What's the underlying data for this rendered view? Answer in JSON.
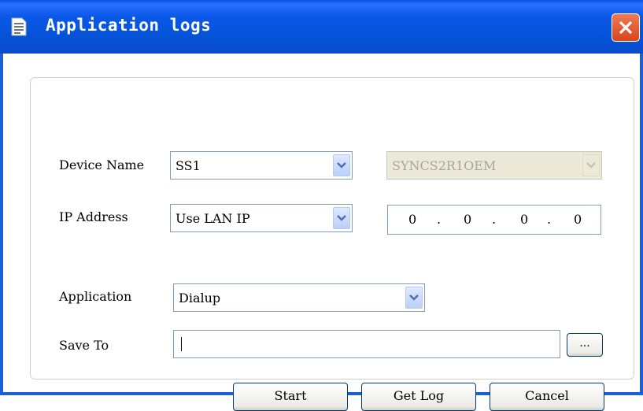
{
  "window": {
    "title": "Application logs",
    "title_icon": "document-icon",
    "close_icon": "close-icon"
  },
  "form": {
    "device_name": {
      "label": "Device Name",
      "value": "SS1",
      "secondary_value": "SYNCS2R1OEM"
    },
    "ip_address": {
      "label": "IP Address",
      "value": "Use LAN IP",
      "octets": [
        "0",
        "0",
        "0",
        "0"
      ],
      "separator": "."
    },
    "application": {
      "label": "Application",
      "value": "Dialup"
    },
    "save_to": {
      "label": "Save To",
      "value": "",
      "browse_label": "..."
    }
  },
  "buttons": {
    "start": "Start",
    "get_log": "Get Log",
    "cancel": "Cancel"
  },
  "colors": {
    "title_bar": "#0552d8",
    "close_button": "#d6451e",
    "dropdown_arrow": "#4d6fb8"
  }
}
